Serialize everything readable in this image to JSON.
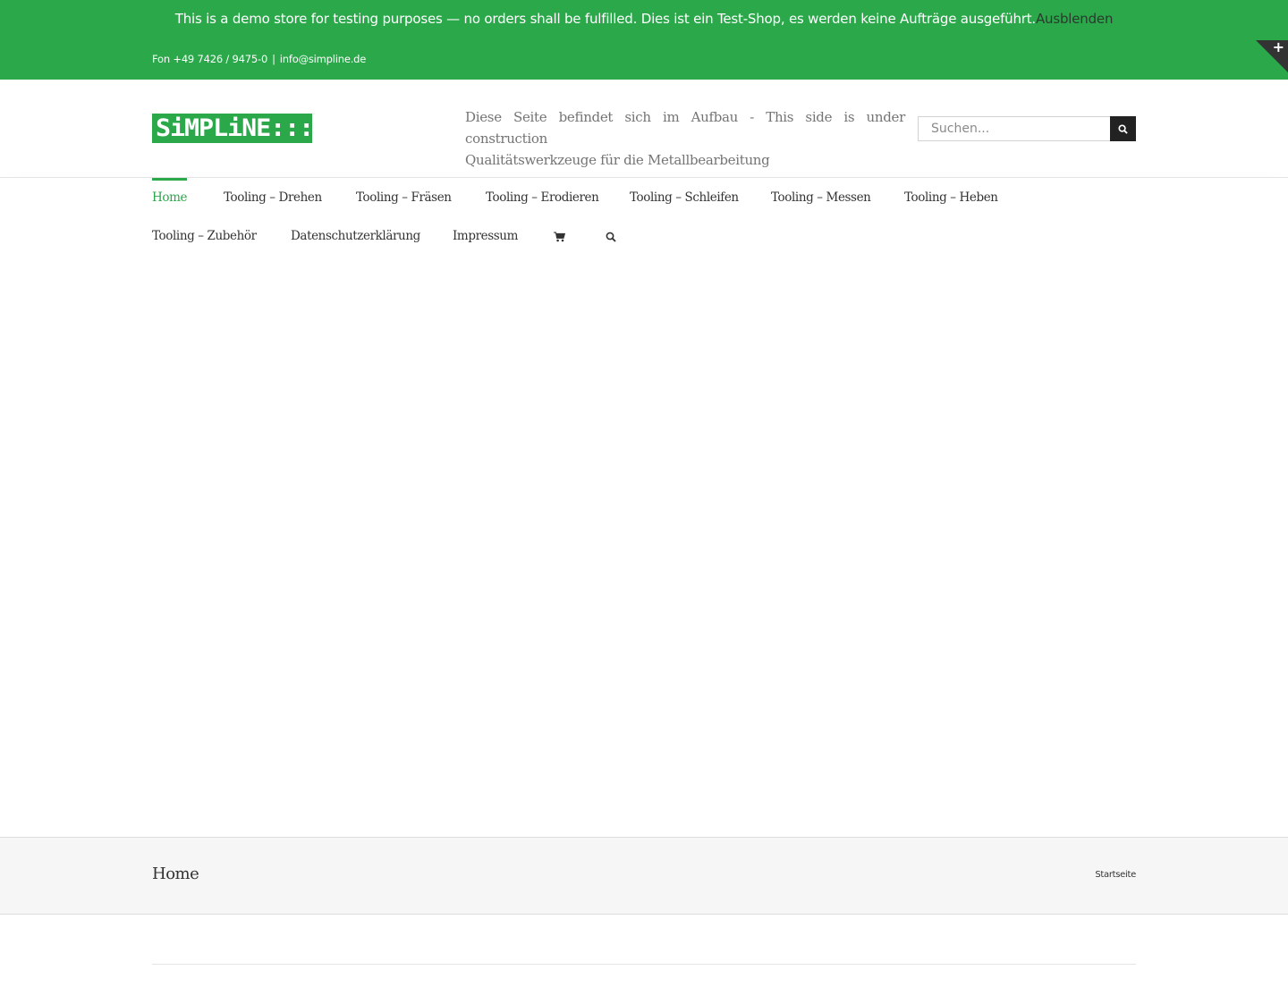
{
  "demo_store": {
    "notice": "This is a demo store for testing purposes — no orders shall be fulfilled. Dies ist ein Test-Shop, es werden keine Aufträge ausgeführt.",
    "dismiss_label": "Ausblenden"
  },
  "top_bar": {
    "phone": "Fon +49 7426 / 9475-0",
    "separator": "|",
    "email": "info@simpline.de",
    "toggle_label": "+"
  },
  "header": {
    "logo_text": "SiMPLiNE:::",
    "tagline_line1": "Diese Seite befindet sich im Aufbau - This side is under construction",
    "tagline_line2": "Qualitätswerkzeuge für die Metallbearbeitung",
    "search_placeholder": "Suchen...",
    "search_icon": "search-icon"
  },
  "nav": {
    "items": [
      {
        "label": "Home",
        "active": true
      },
      {
        "label": "Tooling – Drehen"
      },
      {
        "label": "Tooling – Fräsen"
      },
      {
        "label": "Tooling – Erodieren"
      },
      {
        "label": "Tooling – Schleifen"
      },
      {
        "label": "Tooling – Messen"
      },
      {
        "label": "Tooling – Heben"
      },
      {
        "label": "Tooling – Zubehör"
      },
      {
        "label": "Datenschutzerklärung"
      },
      {
        "label": "Impressum"
      }
    ],
    "cart_icon": "cart-icon",
    "search_icon": "search-icon"
  },
  "page_title_bar": {
    "title": "Home",
    "breadcrumb": "Startseite"
  },
  "colors": {
    "brand_green": "#2aa84a",
    "dark": "#333333"
  }
}
